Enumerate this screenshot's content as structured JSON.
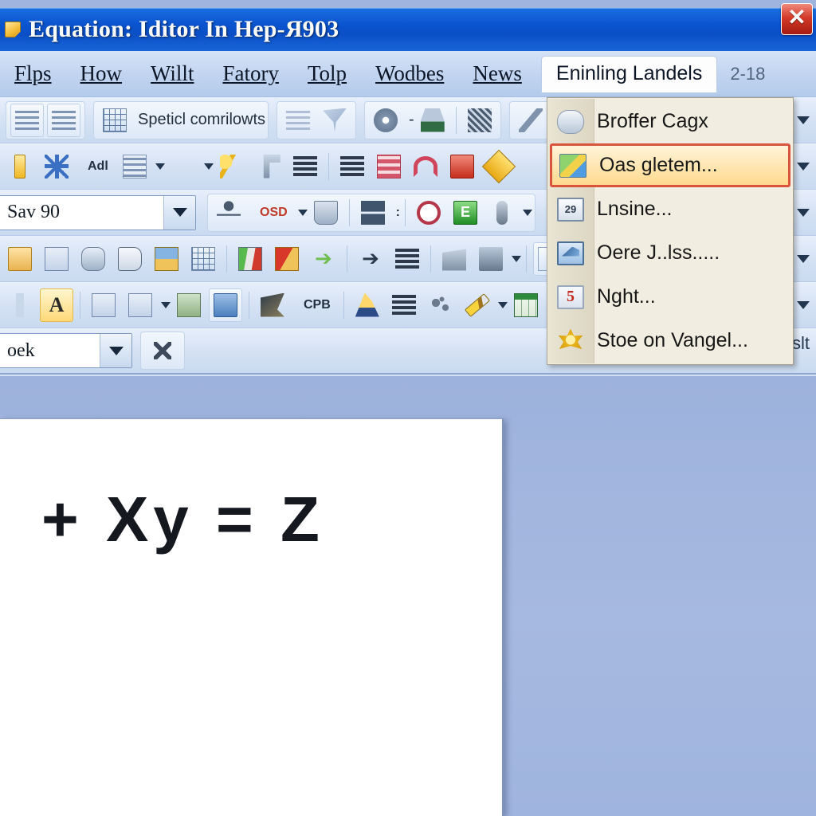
{
  "window": {
    "title": "Equation: Iditor In Hep-Я903",
    "app_icon": "document-icon",
    "close_label": "✕"
  },
  "menubar": {
    "items": [
      {
        "label": "Flps",
        "accel": "F"
      },
      {
        "label": "How",
        "accel": "H"
      },
      {
        "label": "Willt",
        "accel": "W"
      },
      {
        "label": "Fatory",
        "accel": "F"
      },
      {
        "label": "Tolp",
        "accel": "T"
      },
      {
        "label": "Wodbes",
        "accel": "W"
      },
      {
        "label": "News",
        "accel": "N"
      }
    ],
    "active_item": {
      "label": "Eninling Landels",
      "accel": "E"
    },
    "clock": "2-18"
  },
  "dropdown": {
    "items": [
      {
        "label": "Broffer Cagx",
        "icon": "cloud-icon",
        "selected": false
      },
      {
        "label": "Oas gletem...",
        "icon": "folders-icon",
        "selected": true
      },
      {
        "label": "Lnsine...",
        "icon": "calendar-icon",
        "selected": false
      },
      {
        "label": "Oere J..lss.....",
        "icon": "window-icon",
        "selected": false
      },
      {
        "label": "Nght...",
        "icon": "monitor-icon",
        "selected": false
      },
      {
        "label": "Stoe on Vangel...",
        "icon": "badge-icon",
        "selected": false
      }
    ]
  },
  "toolbars": {
    "row1": {
      "group1": [
        {
          "icon": "page-left-icon"
        },
        {
          "icon": "page-right-icon"
        }
      ],
      "special_button": {
        "label": "Speticl comrilowts",
        "icon": "table-chart-icon"
      },
      "group3": [
        {
          "icon": "cart-icon"
        },
        {
          "icon": "bird-icon"
        }
      ],
      "group4": [
        {
          "icon": "gear-icon"
        },
        {
          "icon": "dash-icon",
          "label": "-"
        },
        {
          "icon": "stamp-icon"
        }
      ],
      "group5": [
        {
          "icon": "tools-icon"
        }
      ],
      "group6": [
        {
          "icon": "check-mark-icon"
        }
      ],
      "group7": [
        {
          "icon": "column-icon"
        }
      ]
    },
    "row2": {
      "items": [
        {
          "icon": "snowflake-icon"
        },
        {
          "icon": "text-icon",
          "label": "Adl"
        },
        {
          "icon": "stack-lines-icon",
          "caret": true
        },
        {
          "icon": "caret-only-icon",
          "caret": true
        },
        {
          "icon": "key-icon"
        },
        {
          "icon": "pipe-tool-icon"
        },
        {
          "icon": "align-left-icon"
        },
        {
          "icon": "align-justify-icon"
        },
        {
          "icon": "red-table-icon"
        },
        {
          "icon": "headset-icon"
        },
        {
          "icon": "copy-red-icon"
        },
        {
          "icon": "diamond-icon"
        }
      ]
    },
    "row3": {
      "combo": {
        "value": "Sav 90"
      },
      "items": [
        {
          "icon": "person-icon"
        },
        {
          "icon": "osd-icon",
          "label": "OSD",
          "caret": true
        },
        {
          "icon": "inbox-icon"
        },
        {
          "icon": "layout-icon"
        },
        {
          "icon": "colon-icon",
          "label": ":"
        },
        {
          "icon": "target-icon"
        },
        {
          "icon": "green-e-icon",
          "label": "E"
        },
        {
          "icon": "pill-icon",
          "caret": true
        }
      ]
    },
    "row4": {
      "items": [
        {
          "icon": "folder-open-icon"
        },
        {
          "icon": "blue-doc-icon"
        },
        {
          "icon": "printer-icon"
        },
        {
          "icon": "hand-icon"
        },
        {
          "icon": "upload-folder-icon"
        },
        {
          "icon": "calendar-click-icon"
        },
        {
          "icon": "people-icon"
        },
        {
          "icon": "red-folder-icon"
        },
        {
          "icon": "green-arrow-icon"
        },
        {
          "icon": "arrow-right-icon"
        },
        {
          "icon": "lines-icon"
        },
        {
          "icon": "film-icon"
        },
        {
          "icon": "presentation-icon",
          "caret": true
        }
      ]
    },
    "row5": {
      "items": [
        {
          "icon": "font-a-icon",
          "highlighted": true
        },
        {
          "icon": "copy-page-icon"
        },
        {
          "icon": "stacked-doc-icon",
          "caret": true
        },
        {
          "icon": "note-icon"
        },
        {
          "icon": "photo-icon"
        },
        {
          "icon": "bird-dark-icon"
        },
        {
          "icon": "cpb-icon",
          "label": "CPB"
        },
        {
          "icon": "flame-icon"
        },
        {
          "icon": "align-lines-icon"
        },
        {
          "icon": "splatter-icon"
        },
        {
          "icon": "pencil-icon",
          "caret": true
        },
        {
          "icon": "spreadsheet-icon"
        },
        {
          "icon": "red-book-icon"
        }
      ]
    },
    "row6": {
      "combo": {
        "value": "oek"
      },
      "items": [
        {
          "icon": "scissors-icon"
        }
      ]
    }
  },
  "document": {
    "equation": "+ Xy = Z"
  },
  "misc": {
    "right_stub": "slt"
  },
  "colors": {
    "titlebar_blue": "#0b4fc6",
    "workspace_blue": "#9fb4de",
    "menu_panel": "#f1ede0",
    "selection_border": "#d9543a",
    "selection_fill": "#ffd98e",
    "close_red": "#c62d1c"
  }
}
